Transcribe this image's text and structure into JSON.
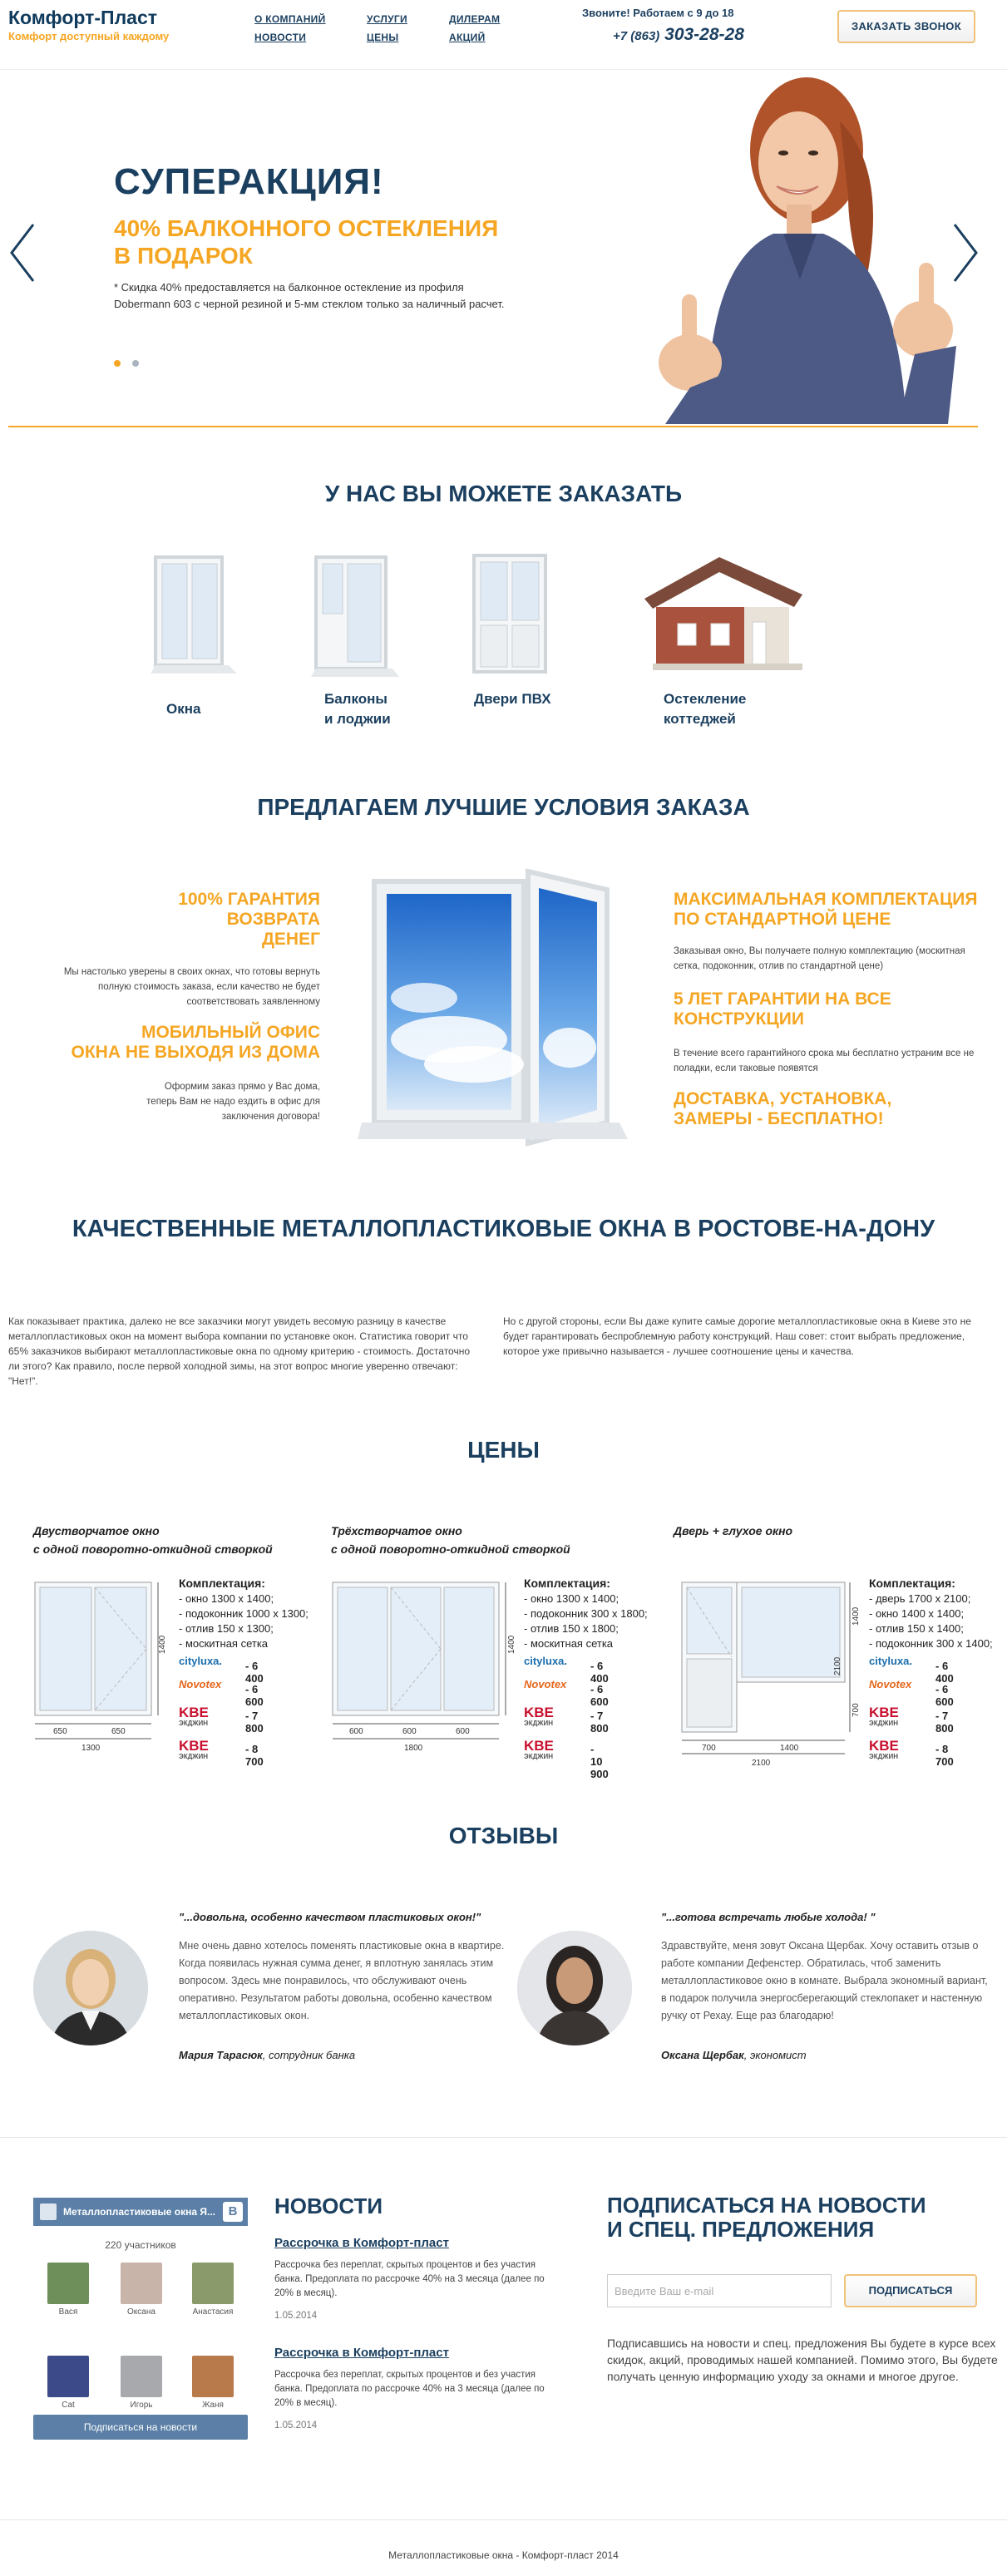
{
  "header": {
    "brand": "Комфорт-Пласт",
    "tagline": "Комфорт доступный каждому",
    "nav": [
      [
        "О КОМПАНИЙ",
        "НОВОСТИ"
      ],
      [
        "УСЛУГИ",
        "ЦЕНЫ"
      ],
      [
        "ДИЛЕРАМ",
        "АКЦИЙ"
      ]
    ],
    "call_hours": "Звоните! Работаем с 9 до 18",
    "phone_code": "+7 (863)",
    "phone_number": "303-28-28",
    "call_button": "ЗАКАЗАТЬ ЗВОНОК"
  },
  "slider": {
    "title": "СУПЕРАКЦИЯ!",
    "subtitle_line1": "40% БАЛКОННОГО ОСТЕКЛЕНИЯ",
    "subtitle_line2": "В ПОДАРОК",
    "text": "* Скидка 40% предоставляется на балконное остекление из профиля Dobermann 603 с черной резиной и 5-мм стеклом только за наличный расчет.",
    "active_dot": 0,
    "colors": {
      "accent": "#f5a623",
      "navy": "#1b3f5f"
    }
  },
  "order": {
    "heading": "У НАС ВЫ МОЖЕТЕ ЗАКАЗАТЬ",
    "items": [
      {
        "label_1": "Окна",
        "label_2": ""
      },
      {
        "label_1": "Балконы",
        "label_2": "и лоджии"
      },
      {
        "label_1": "Двери ПВХ",
        "label_2": ""
      },
      {
        "label_1": "Остекление",
        "label_2": "коттеджей"
      }
    ]
  },
  "conditions": {
    "heading": "ПРЕДЛАГАЕМ ЛУЧШИЕ УСЛОВИЯ ЗАКАЗА",
    "left": [
      {
        "title_1": "100% ГАРАНТИЯ",
        "title_2": "ВОЗВРАТА",
        "title_3": "ДЕНЕГ",
        "text": "Мы настолько уверены в своих окнах, что готовы вернуть полную стоимость заказа, если качество не будет соответствовать заявленному"
      },
      {
        "title_1": "МОБИЛЬНЫЙ ОФИС",
        "title_2": "ОКНА НЕ ВЫХОДЯ ИЗ ДОМА",
        "title_3": "",
        "text": "Оформим заказ прямо у Вас дома, теперь Вам не надо ездить в офис для заключения договора!"
      }
    ],
    "right": [
      {
        "title_1": "МАКСИМАЛЬНАЯ КОМПЛЕКТАЦИЯ",
        "title_2": "ПО СТАНДАРТНОЙ ЦЕНЕ",
        "text": "Заказывая окно, Вы получаете полную комплектацию (москитная сетка, подоконник, отлив по стандартной цене)"
      },
      {
        "title_1": "5 ЛЕТ ГАРАНТИИ НА ВСЕ",
        "title_2": "КОНСТРУКЦИИ",
        "text": "В течение всего гарантийного срока мы бесплатно устраним все не поладки, если таковые появятся"
      },
      {
        "title_1": "ДОСТАВКА, УСТАНОВКА,",
        "title_2": "ЗАМЕРЫ - БЕСПЛАТНО!",
        "text": ""
      }
    ]
  },
  "seo": {
    "heading": "КАЧЕСТВЕННЫЕ МЕТАЛЛОПЛАСТИКОВЫЕ ОКНА В РОСТОВЕ-НА-ДОНУ",
    "left": "Как показывает практика, далеко не все заказчики могут увидеть весомую разницу в качестве металлопластиковых окон на момент выбора компании по установке окон. Статистика говорит что 65% заказчиков выбирают металлопластиковые окна по одному критерию - стоимость. Достаточно ли этого? Как правило, после первой холодной зимы, на этот вопрос многие уверенно отвечают: \"Нет!\".",
    "right": "Но с другой стороны, если Вы даже купите самые дорогие металлопластиковые окна в Киеве это не будет гарантировать беспроблемную работу конструкций. Наш совет: стоит выбрать предложение, которое уже привычно называется - лучшее соотношение цены и качества."
  },
  "prices": {
    "heading": "ЦЕНЫ",
    "spec_title": "Комплектация:",
    "cards": [
      {
        "title_1": "Двустворчатое окно",
        "title_2": "с одной поворотно-откидной створкой",
        "specs": [
          "- окно 1300 х 1400;",
          "- подоконник 1000 х 1300;",
          "- отлив 150 х 1300;",
          "- москитная сетка"
        ],
        "dims": {
          "w1": "650",
          "w2": "650",
          "total": "1300",
          "h": "1400"
        },
        "brands": [
          {
            "name": "cityluxa.",
            "price": "- 6 400"
          },
          {
            "name": "Novotex",
            "price": "- 6 600"
          },
          {
            "name": "KBE",
            "price": "- 7 800"
          },
          {
            "name": "KBE",
            "price": "- 8 700"
          }
        ]
      },
      {
        "title_1": "Трёхстворчатое окно",
        "title_2": "с одной поворотно-откидной створкой",
        "specs": [
          "- окно 1300 х 1400;",
          "- подоконник 300 х 1800;",
          "- отлив 150 х 1800;",
          "- москитная сетка"
        ],
        "dims": {
          "w1": "600",
          "w2": "600",
          "w3": "600",
          "total": "1800",
          "h": "1400"
        },
        "brands": [
          {
            "name": "cityluxa.",
            "price": "- 6 400"
          },
          {
            "name": "Novotex",
            "price": "- 6 600"
          },
          {
            "name": "KBE",
            "price": "- 7 800"
          },
          {
            "name": "KBE",
            "price": "- 10 900"
          }
        ]
      },
      {
        "title_1": "Дверь + глухое окно",
        "title_2": "",
        "specs": [
          "- дверь 1700 х 2100;",
          "- окно 1400 х 1400;",
          "- отлив 150 х 1400;",
          "- подоконник 300 х 1400;"
        ],
        "dims": {
          "w1": "700",
          "w2": "1400",
          "total": "2100",
          "h": "2100",
          "h2": "1400",
          "h3": "700"
        },
        "brands": [
          {
            "name": "cityluxa.",
            "price": "- 6 400"
          },
          {
            "name": "Novotex",
            "price": "- 6 600"
          },
          {
            "name": "KBE",
            "price": "- 7 800"
          },
          {
            "name": "KBE",
            "price": "- 8 700"
          }
        ]
      }
    ],
    "kbe_sub": "ЭКДЖИН"
  },
  "reviews": {
    "heading": "ОТЗЫВЫ",
    "items": [
      {
        "quote": "\"...довольна, особенно качеством пластиковых окон!\"",
        "text": "Мне очень давно хотелось поменять пластиковые окна в квартире. Когда появилась нужная сумма денег, я вплотную занялась этим вопросом. Здесь мне понравилось, что обслуживают очень оперативно. Результатом работы довольна, особенно качеством металлопластиковых окон.",
        "author": "Мария Тарасюк",
        "role": ", сотрудник банка"
      },
      {
        "quote": "\"...готова встречать любые холода! \"",
        "text": "Здравствуйте, меня зовут Оксана Щербак. Хочу оставить отзыв о работе компании Дефенстер. Обратилась, чтоб заменить металлопластиковое окно в комнате. Выбрала экономный вариант, в подарок получила энергосберегающий стеклопакет и настенную ручку от Рехау. Еще раз благодарю!",
        "author": "Оксана Щербак",
        "role": ", экономист"
      }
    ]
  },
  "vk": {
    "group_name": "Металлопластиковые окна Я...",
    "vk_letter": "B",
    "members_count": "220 участников",
    "members": [
      "Вася",
      "Оксана",
      "Анастасия",
      "Cat",
      "Игорь",
      "Жаня"
    ],
    "join_button": "Подписаться на новости"
  },
  "news": {
    "heading": "НОВОСТИ",
    "items": [
      {
        "title": "Рассрочка в Комфорт-пласт",
        "text": "Рассрочка без переплат, скрытых процентов и без участия банка. Предоплата по рассрочке 40% на 3 месяца (далее по 20% в месяц).",
        "date": "1.05.2014"
      },
      {
        "title": "Рассрочка в Комфорт-пласт",
        "text": "Рассрочка без переплат, скрытых процентов и без участия банка. Предоплата по рассрочке 40% на 3 месяца (далее по 20% в месяц).",
        "date": "1.05.2014"
      }
    ]
  },
  "subscribe": {
    "heading_1": "ПОДПИСАТЬСЯ НА НОВОСТИ",
    "heading_2": "И СПЕЦ. ПРЕДЛОЖЕНИЯ",
    "placeholder": "Введите Ваш e-mail",
    "button": "ПОДПИСАТЬСЯ",
    "text": "Подписавшись на новости и спец. предложения Вы будете в курсе всех скидок, акций, проводимых нашей компанией. Помимо этого, Вы будете получать ценную информацию уходу за окнами и многое другое."
  },
  "footer": {
    "copyright": "Металлопластиковые окна - Комфорт-пласт 2014"
  }
}
